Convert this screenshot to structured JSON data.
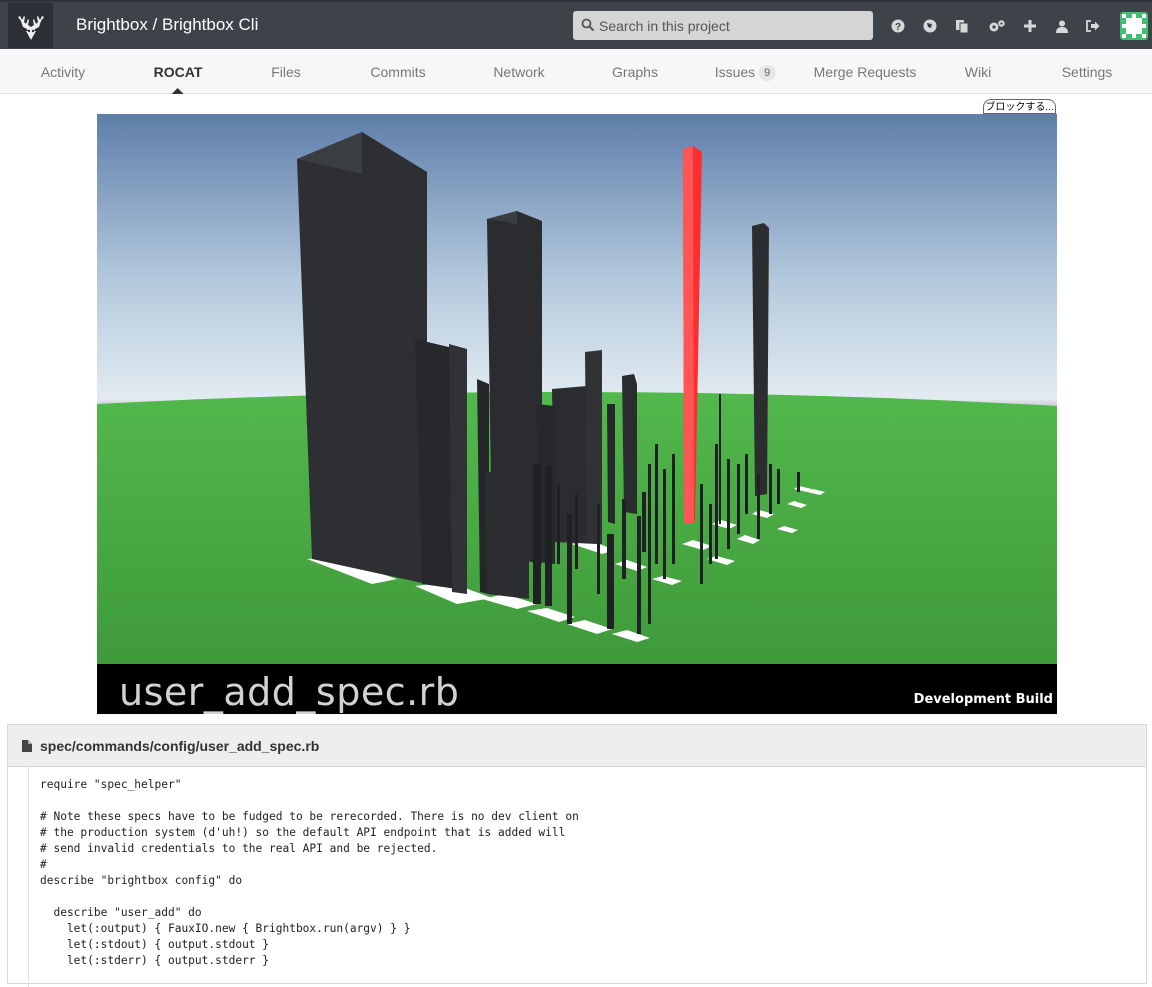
{
  "header": {
    "title": "Brightbox / Brightbox Cli",
    "search_placeholder": "Search in this project",
    "icons": [
      "help-icon",
      "explore-icon",
      "snippets-icon",
      "admin-icon",
      "new-project-icon",
      "profile-icon",
      "logout-icon"
    ]
  },
  "nav": {
    "tabs": [
      {
        "label": "Activity",
        "active": false
      },
      {
        "label": "ROCAT",
        "active": true
      },
      {
        "label": "Files",
        "active": false
      },
      {
        "label": "Commits",
        "active": false
      },
      {
        "label": "Network",
        "active": false
      },
      {
        "label": "Graphs",
        "active": false
      },
      {
        "label": "Issues",
        "count": "9",
        "active": false
      },
      {
        "label": "Merge Requests",
        "active": false
      },
      {
        "label": "Wiki",
        "active": false
      },
      {
        "label": "Settings",
        "active": false
      }
    ]
  },
  "block_button": "ブロックする...",
  "viewer": {
    "file_label": "user_add_spec.rb",
    "build_label": "Development Build",
    "colors": {
      "sky_top": "#5e7eaa",
      "horizon": "#d9e4ec",
      "ground": "#53bf53",
      "building": "#2b2d31",
      "highlight": "#ff3030"
    }
  },
  "file": {
    "path": "spec/commands/config/user_add_spec.rb",
    "lines": [
      "require \"spec_helper\"",
      "",
      "# Note these specs have to be fudged to be rerecorded. There is no dev client on",
      "# the production system (d'uh!) so the default API endpoint that is added will",
      "# send invalid credentials to the real API and be rejected.",
      "#",
      "describe \"brightbox config\" do",
      "",
      "  describe \"user_add\" do",
      "    let(:output) { FauxIO.new { Brightbox.run(argv) } }",
      "    let(:stdout) { output.stdout }",
      "    let(:stderr) { output.stderr }"
    ]
  }
}
